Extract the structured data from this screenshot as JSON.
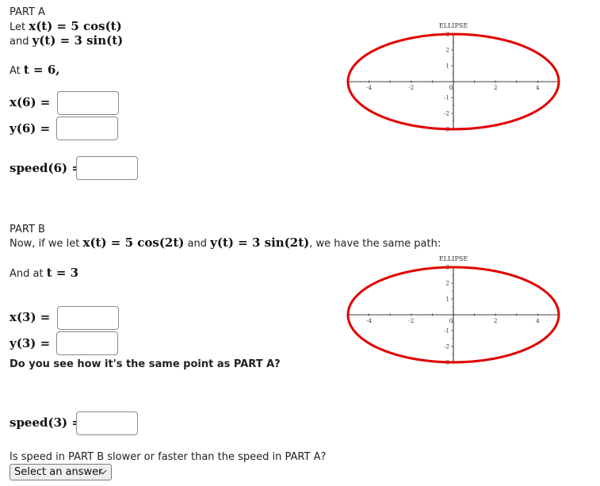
{
  "part_a": {
    "heading": "PART A",
    "let_prefix": "Let ",
    "x_def": "x(t) = 5 cos(t)",
    "and_prefix": "and ",
    "y_def": "y(t) = 3 sin(t)",
    "at_prefix": "At ",
    "at_value": "t = 6,",
    "x_label": "x(6) =",
    "y_label": "y(6) =",
    "speed_label": "speed(6) =",
    "x_input": {
      "value": "",
      "placeholder": ""
    },
    "y_input": {
      "value": "",
      "placeholder": ""
    },
    "speed_input": {
      "value": "",
      "placeholder": ""
    }
  },
  "part_b": {
    "heading": "PART B",
    "intro_prefix": "Now, if we let ",
    "x_def": "x(t) = 5 cos(2t)",
    "and_word": " and ",
    "y_def": "y(t) = 3 sin(2t)",
    "intro_suffix": ", we have the same path:",
    "at_prefix": "And at ",
    "at_value": "t = 3",
    "x_label": "x(3) =",
    "y_label": "y(3) =",
    "same_point_question": "Do you see how it's the same point as PART A?",
    "speed_label": "speed(3) =",
    "x_input": {
      "value": "",
      "placeholder": ""
    },
    "y_input": {
      "value": "",
      "placeholder": ""
    },
    "speed_input": {
      "value": "",
      "placeholder": ""
    },
    "compare_question": "Is speed in PART B slower or faster than the speed in PART A?",
    "select": {
      "selected": "Select an answer"
    }
  },
  "colors": {
    "curve": "#e00000",
    "axis": "#666666"
  },
  "chart_data": [
    {
      "type": "line",
      "title": "ELLIPSE",
      "description": "x = 5cos(t), y = 3sin(t)",
      "semi_axis_x": 5,
      "semi_axis_y": 3,
      "xlim": [
        -5,
        5
      ],
      "ylim": [
        -3,
        3
      ],
      "x_ticks": [
        "-4",
        "-2",
        "0",
        "2",
        "4"
      ],
      "y_ticks": [
        "3",
        "2",
        "1",
        "-1",
        "-2",
        "-3"
      ],
      "xlabel": "",
      "ylabel": "",
      "grid": false
    },
    {
      "type": "line",
      "title": "ELLIPSE",
      "description": "x = 5cos(2t), y = 3sin(2t)",
      "semi_axis_x": 5,
      "semi_axis_y": 3,
      "xlim": [
        -5,
        5
      ],
      "ylim": [
        -3,
        3
      ],
      "x_ticks": [
        "-4",
        "-2",
        "0",
        "2",
        "4"
      ],
      "y_ticks": [
        "3",
        "2",
        "1",
        "-1",
        "-2",
        "-3"
      ],
      "xlabel": "",
      "ylabel": "",
      "grid": false
    }
  ]
}
